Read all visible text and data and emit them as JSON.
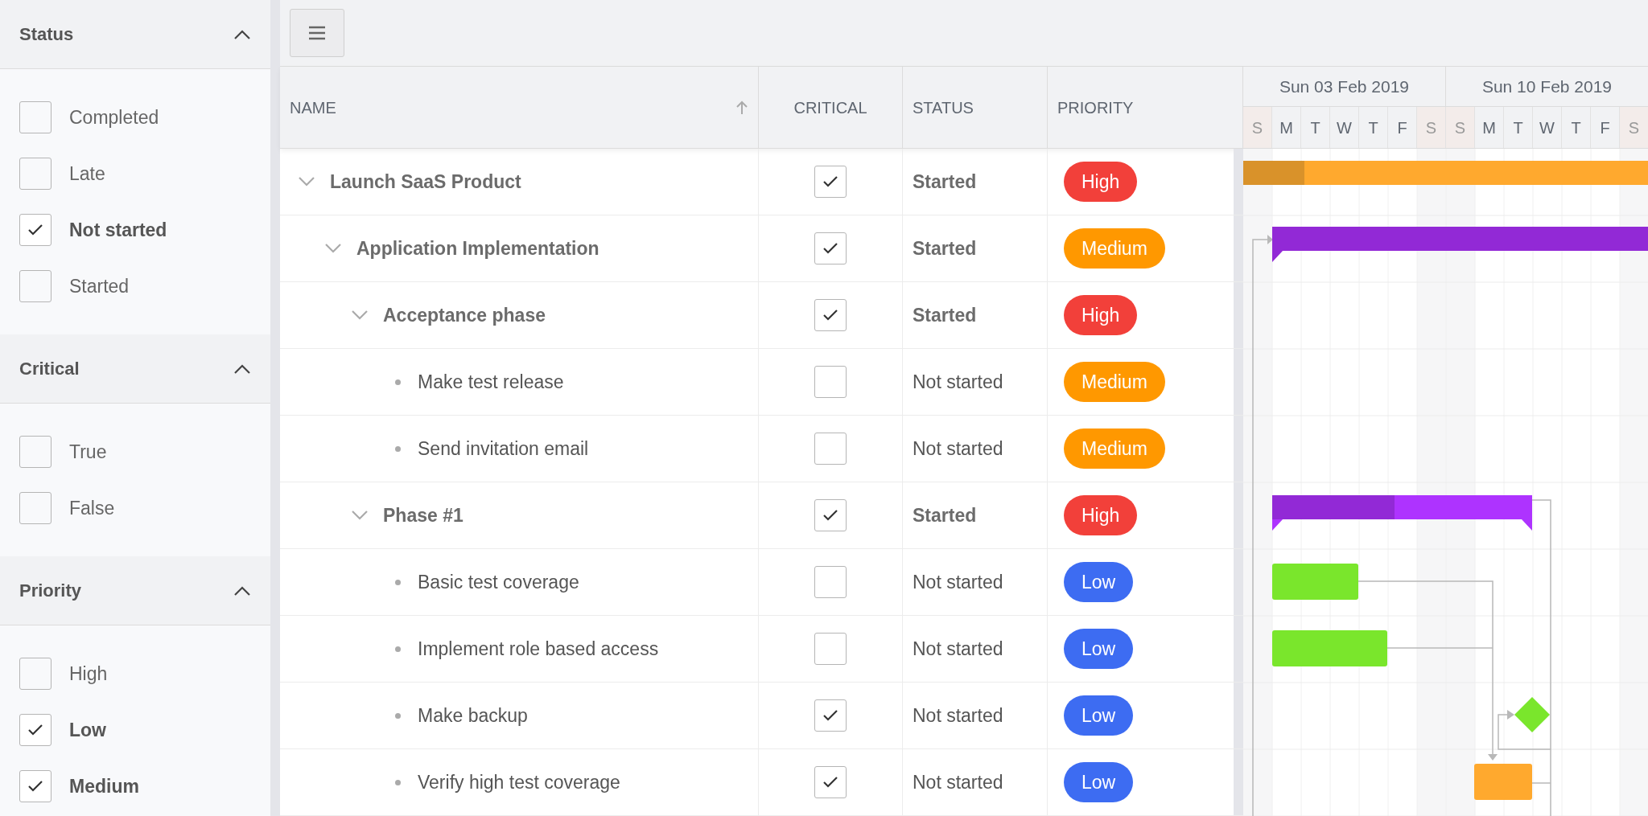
{
  "filters": [
    {
      "title": "Status",
      "expanded": true,
      "options": [
        {
          "label": "Completed",
          "checked": false
        },
        {
          "label": "Late",
          "checked": false
        },
        {
          "label": "Not started",
          "checked": true
        },
        {
          "label": "Started",
          "checked": false
        }
      ]
    },
    {
      "title": "Critical",
      "expanded": true,
      "options": [
        {
          "label": "True",
          "checked": false
        },
        {
          "label": "False",
          "checked": false
        }
      ]
    },
    {
      "title": "Priority",
      "expanded": true,
      "options": [
        {
          "label": "High",
          "checked": false
        },
        {
          "label": "Low",
          "checked": true
        },
        {
          "label": "Medium",
          "checked": true
        }
      ]
    }
  ],
  "table": {
    "columns": [
      {
        "label": "NAME",
        "sorted": true
      },
      {
        "label": "CRITICAL",
        "sorted": false
      },
      {
        "label": "STATUS",
        "sorted": false
      },
      {
        "label": "PRIORITY",
        "sorted": false
      }
    ],
    "rows": [
      {
        "name": "Launch SaaS Product",
        "critical": true,
        "status": "Started",
        "priority": {
          "label": "High",
          "color": "#f2403a"
        },
        "expanded": true,
        "children": [
          {
            "name": "Application Implementation",
            "critical": true,
            "status": "Started",
            "priority": {
              "label": "Medium",
              "color": "#ff9800"
            },
            "expanded": true,
            "children": [
              {
                "name": "Acceptance phase",
                "critical": true,
                "status": "Started",
                "priority": {
                  "label": "High",
                  "color": "#f2403a"
                },
                "expanded": true,
                "children": [
                  {
                    "name": "Make test release",
                    "critical": false,
                    "status": "Not started",
                    "priority": {
                      "label": "Medium",
                      "color": "#ff9800"
                    }
                  },
                  {
                    "name": "Send invitation email",
                    "critical": false,
                    "status": "Not started",
                    "priority": {
                      "label": "Medium",
                      "color": "#ff9800"
                    }
                  }
                ]
              },
              {
                "name": "Phase #1",
                "critical": true,
                "status": "Started",
                "priority": {
                  "label": "High",
                  "color": "#f2403a"
                },
                "expanded": true,
                "children": [
                  {
                    "name": "Basic test coverage",
                    "critical": false,
                    "status": "Not started",
                    "priority": {
                      "label": "Low",
                      "color": "#3d6cf2"
                    }
                  },
                  {
                    "name": "Implement role based access",
                    "critical": false,
                    "status": "Not started",
                    "priority": {
                      "label": "Low",
                      "color": "#3d6cf2"
                    }
                  },
                  {
                    "name": "Make backup",
                    "critical": true,
                    "status": "Not started",
                    "priority": {
                      "label": "Low",
                      "color": "#3d6cf2"
                    }
                  },
                  {
                    "name": "Verify high test coverage",
                    "critical": true,
                    "status": "Not started",
                    "priority": {
                      "label": "Low",
                      "color": "#3d6cf2"
                    }
                  }
                ]
              }
            ]
          }
        ]
      }
    ]
  },
  "timeline": {
    "weeks": [
      {
        "label": "Sun 03 Feb 2019",
        "days": [
          {
            "label": "S",
            "weekend": true
          },
          {
            "label": "M",
            "weekend": false
          },
          {
            "label": "T",
            "weekend": false
          },
          {
            "label": "W",
            "weekend": false
          },
          {
            "label": "T",
            "weekend": false
          },
          {
            "label": "F",
            "weekend": false
          },
          {
            "label": "S",
            "weekend": true
          }
        ]
      },
      {
        "label": "Sun 10 Feb 2019",
        "days": [
          {
            "label": "S",
            "weekend": true
          },
          {
            "label": "M",
            "weekend": false
          },
          {
            "label": "T",
            "weekend": false
          },
          {
            "label": "W",
            "weekend": false
          },
          {
            "label": "T",
            "weekend": false
          },
          {
            "label": "F",
            "weekend": false
          },
          {
            "label": "S",
            "weekend": true
          }
        ]
      }
    ]
  }
}
